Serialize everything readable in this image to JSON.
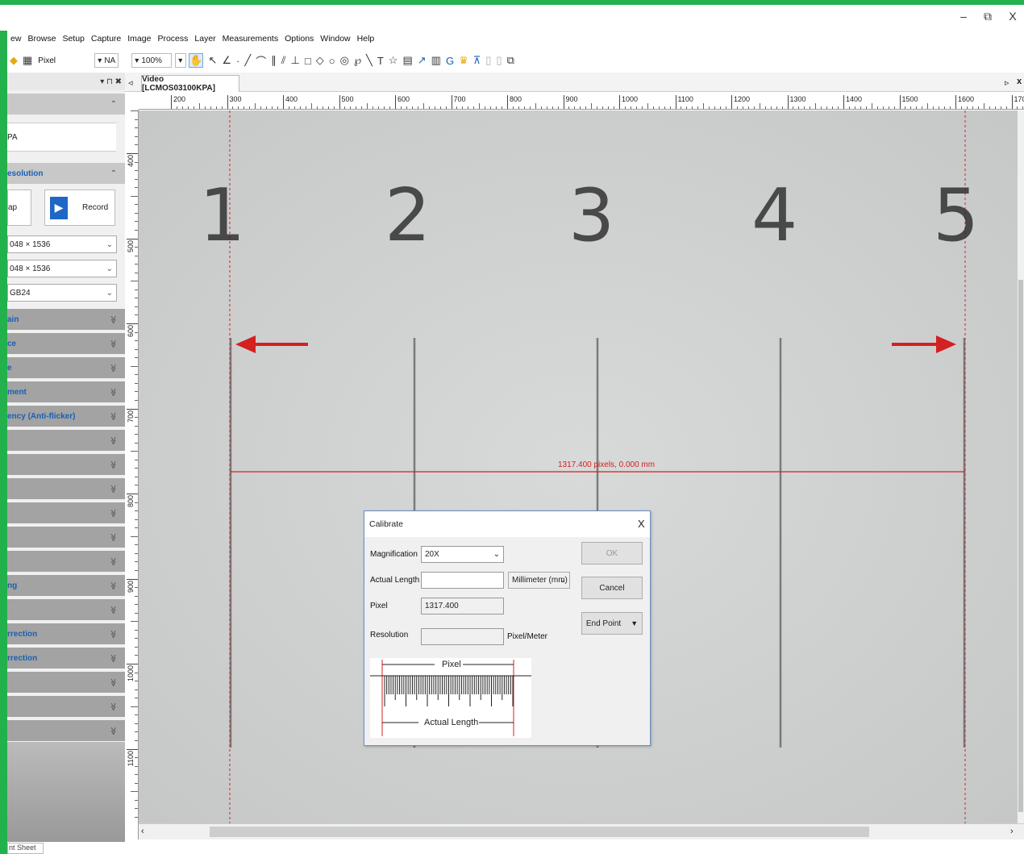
{
  "window": {
    "minimize_glyph": "–",
    "restore_glyph": "⧉",
    "close_glyph": "X"
  },
  "menu": [
    "ew",
    "Browse",
    "Setup",
    "Capture",
    "Image",
    "Process",
    "Layer",
    "Measurements",
    "Options",
    "Window",
    "Help"
  ],
  "toolbar": {
    "unit": "Pixel",
    "na": "NA",
    "zoom": "100%"
  },
  "left_panel": {
    "pin_glyphs": "▾ ⊓ ✖",
    "camera_name": "PA",
    "resolution_header": "esolution",
    "snap_label": "ap",
    "record_label": "Record",
    "selects": [
      "048 × 1536",
      "048 × 1536",
      "GB24"
    ],
    "sections": [
      "ain",
      "ce",
      "e",
      "ment",
      "ency (Anti-flicker)",
      "",
      "",
      "",
      "",
      "",
      "",
      "ng",
      "",
      "rrection",
      "rrection",
      "",
      "",
      ""
    ]
  },
  "tab": {
    "label": "Video [LCMOS03100KPA]"
  },
  "ruler": {
    "h_labels": [
      "200",
      "300",
      "400",
      "500",
      "600",
      "700",
      "800",
      "900",
      "1000",
      "1100",
      "1200",
      "1300",
      "1400",
      "1500",
      "1600",
      "1700"
    ],
    "v_labels": [
      "400",
      "500",
      "600",
      "700",
      "800",
      "900",
      "1000",
      "1100",
      "12"
    ]
  },
  "image": {
    "scale_numbers": [
      "1",
      "2",
      "3",
      "4",
      "5"
    ],
    "measurement_label": "1317.400 pixels, 0.000 mm"
  },
  "dialog": {
    "title": "Calibrate",
    "close": "X",
    "magnification_label": "Magnification",
    "magnification_value": "20X",
    "actual_length_label": "Actual Length",
    "actual_length_value": "",
    "unit_value": "Millimeter (mm)",
    "pixel_label": "Pixel",
    "pixel_value": "1317.400",
    "resolution_label": "Resolution",
    "resolution_value": "",
    "resolution_unit": "Pixel/Meter",
    "ok": "OK",
    "cancel": "Cancel",
    "endpoint": "End Point",
    "diagram_pixel": "Pixel",
    "diagram_actual": "Actual Length"
  },
  "bottom_tab": "nt Sheet",
  "colors": {
    "frame": "#22b14c",
    "measure_red": "#d42020",
    "link_blue": "#1a5fb4"
  }
}
